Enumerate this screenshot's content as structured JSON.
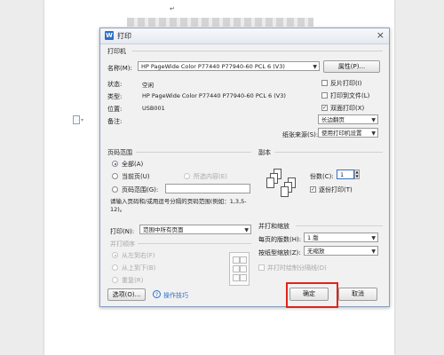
{
  "dialog": {
    "title": "打印",
    "printer": {
      "section": "打印机",
      "name_label": "名称(M):",
      "name_value": "HP PageWide Color P77440 P77940-60 PCL 6 (V3)",
      "properties_btn": "属性(P)...",
      "status_label": "状态:",
      "status_value": "空闲",
      "type_label": "类型:",
      "type_value": "HP PageWide Color P77440 P77940-60 PCL 6 (V3)",
      "location_label": "位置:",
      "location_value": "USB001",
      "comment_label": "备注:",
      "reverse_label": "反片打印(I)",
      "tofile_label": "打印到文件(L)",
      "duplex_label": "双面打印(X)",
      "flip_value": "长边翻页",
      "paper_source_label": "纸张来源(S):",
      "paper_source_value": "使用打印机设置"
    },
    "range": {
      "section": "页码范围",
      "all_label": "全部(A)",
      "current_label": "当前页(U)",
      "selection_label": "所选内容(E)",
      "pages_label": "页码范围(G):",
      "hint": "请输入页码和/或用逗号分隔的页码范围(例如：1,3,5-12)。",
      "print_label": "打印(N):",
      "print_value": "范围中所有页面",
      "order_title": "并打顺序",
      "order_ltr": "从左到右(F)",
      "order_ttb": "从上到下(B)",
      "order_repeat": "重复(R)"
    },
    "copies": {
      "section": "副本",
      "count_label": "份数(C):",
      "count_value": "1",
      "collate_label": "逐份打印(T)"
    },
    "zoom": {
      "section": "并打和缩放",
      "pages_per_sheet_label": "每页的版数(H):",
      "pages_per_sheet_value": "1 版",
      "scale_label": "按纸型缩放(Z):",
      "scale_value": "无缩放",
      "border_label": "并打时绘制分隔线(D)"
    },
    "footer": {
      "options_btn": "选项(O)...",
      "tips_link": "操作技巧",
      "ok_btn": "确定",
      "cancel_btn": "取消"
    }
  },
  "doc": {
    "para_mark": "↵"
  },
  "colors": {
    "highlight": "#e2231a",
    "accent": "#2c70c9"
  }
}
